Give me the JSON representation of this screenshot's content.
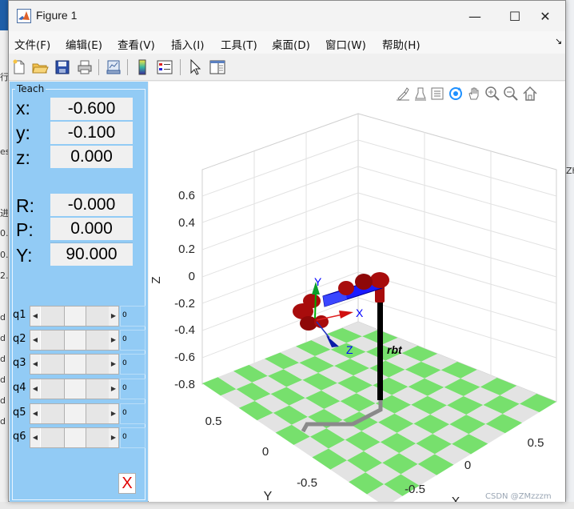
{
  "window": {
    "title": "Figure 1",
    "minimize": "—",
    "maximize": "☐",
    "close": "✕"
  },
  "menu": [
    "文件(F)",
    "编辑(E)",
    "查看(V)",
    "插入(I)",
    "工具(T)",
    "桌面(D)",
    "窗口(W)",
    "帮助(H)"
  ],
  "menu_overflow": "↘",
  "toolbar": [
    "new-figure-icon",
    "open-file-icon",
    "save-icon",
    "print-icon",
    "link-plot-icon",
    "colorbar-icon",
    "legend-icon",
    "pointer-icon",
    "property-editor-icon"
  ],
  "teach": {
    "title": "Teach",
    "position": [
      {
        "label": "x:",
        "value": "-0.600"
      },
      {
        "label": "y:",
        "value": "-0.100"
      },
      {
        "label": "z:",
        "value": "0.000"
      }
    ],
    "orientation": [
      {
        "label": "R:",
        "value": "-0.000"
      },
      {
        "label": "P:",
        "value": "0.000"
      },
      {
        "label": "Y:",
        "value": "90.000"
      }
    ],
    "joints": [
      {
        "label": "q1",
        "value": "0"
      },
      {
        "label": "q2",
        "value": "0"
      },
      {
        "label": "q3",
        "value": "0"
      },
      {
        "label": "q4",
        "value": "0"
      },
      {
        "label": "q5",
        "value": "0"
      },
      {
        "label": "q6",
        "value": "0"
      }
    ],
    "close_label": "X"
  },
  "axes_toolbar": [
    "brush-icon",
    "data-tip-icon",
    "legend-toggle-icon",
    "rotate-icon",
    "pan-icon",
    "zoom-in-icon",
    "zoom-out-icon",
    "home-icon"
  ],
  "plot": {
    "z_axis_label": "Z",
    "y_axis_label": "Y",
    "x_axis_label": "X",
    "z_ticks": [
      "0.6",
      "0.4",
      "0.2",
      "0",
      "-0.2",
      "-0.4",
      "-0.6",
      "-0.8"
    ],
    "y_ticks": [
      "0.5",
      "0",
      "-0.5"
    ],
    "x_ticks": [
      "0.5",
      "0",
      "-0.5"
    ],
    "robot_name": "rbt",
    "frame_labels": {
      "x": "X",
      "y": "Y",
      "z": "Z"
    },
    "colors": {
      "floor_green": "#77e06d",
      "floor_gray": "#e3e3e3",
      "link_blue": "#1a1aff",
      "joint_red": "#a80c0c",
      "base_black": "#000000"
    }
  },
  "watermark": "CSDN @ZMzzzm",
  "background_fragments": [
    "进",
    "0.",
    "0.",
    "2.",
    "d",
    "d",
    "d",
    "d",
    "d",
    "d",
    "行",
    "es"
  ],
  "background_right": "Zh"
}
